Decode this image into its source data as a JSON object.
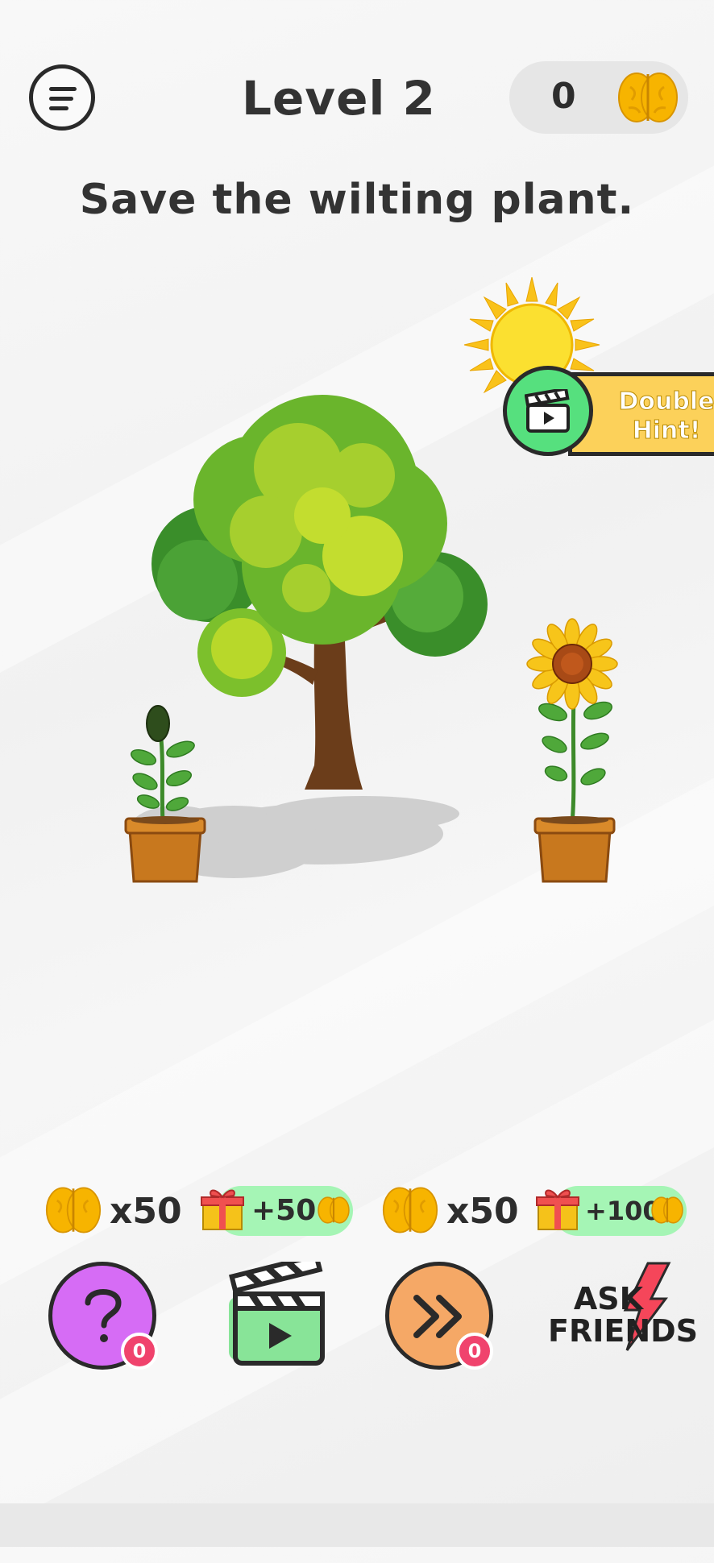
{
  "header": {
    "level_title": "Level 2",
    "score": "0"
  },
  "puzzle": {
    "question": "Save the wilting plant."
  },
  "double_hint": {
    "label_line1": "Double",
    "label_line2": "Hint!"
  },
  "powerups": {
    "hint_cost": "x50",
    "hint_reward": "+50",
    "skip_cost": "x50",
    "skip_reward": "+100",
    "hint_count": "0",
    "skip_count": "0",
    "ask_line1": "ASK",
    "ask_line2": "FRIENDS"
  },
  "colors": {
    "brain": "#f7b400",
    "hint_button": "#d66cf5",
    "video_button": "#88e498",
    "skip_button": "#f5a866",
    "badge": "#f0436d",
    "reward_pill": "#a5f5b5",
    "double_hint_banner": "#fcd15a"
  },
  "icons": {
    "menu": "hamburger-icon",
    "currency": "brain-icon",
    "gift": "gift-icon",
    "video": "clapperboard-icon",
    "hint": "question-mark-icon",
    "skip": "fast-forward-icon",
    "lightning": "lightning-icon"
  }
}
